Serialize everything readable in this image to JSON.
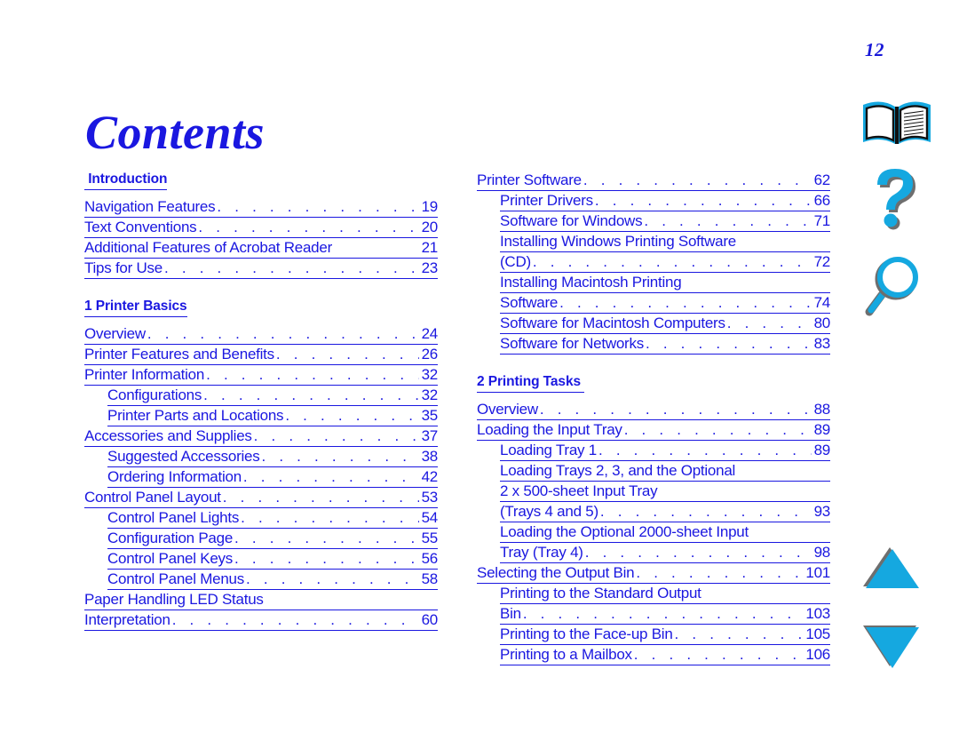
{
  "page": {
    "number": "12",
    "title": "Contents",
    "colors": {
      "link_blue": "#1a17e0",
      "icon_cyan": "#15a8e0",
      "icon_shadow": "#6e6e6e",
      "background": "#ffffff"
    }
  },
  "columns": [
    {
      "name": "left",
      "sections": [
        {
          "heading": " Introduction",
          "spaced_above": false,
          "entries": [
            {
              "level": 1,
              "lines": [
                "Navigation Features"
              ],
              "page": "19"
            },
            {
              "level": 1,
              "lines": [
                "Text Conventions"
              ],
              "page": "20"
            },
            {
              "level": 1,
              "lines": [
                "Additional Features of Acrobat Reader"
              ],
              "page": "21",
              "no_leader": true
            },
            {
              "level": 1,
              "lines": [
                "Tips for Use"
              ],
              "page": "23"
            }
          ]
        },
        {
          "heading": "1 Printer Basics",
          "spaced_above": true,
          "entries": [
            {
              "level": 1,
              "lines": [
                "Overview"
              ],
              "page": "24"
            },
            {
              "level": 1,
              "lines": [
                "Printer Features and Benefits"
              ],
              "page": "26"
            },
            {
              "level": 1,
              "lines": [
                "Printer Information"
              ],
              "page": "32"
            },
            {
              "level": 2,
              "lines": [
                "Configurations"
              ],
              "page": "32"
            },
            {
              "level": 2,
              "lines": [
                "Printer Parts and Locations"
              ],
              "page": "35"
            },
            {
              "level": 1,
              "lines": [
                "Accessories and Supplies"
              ],
              "page": "37"
            },
            {
              "level": 2,
              "lines": [
                "Suggested Accessories"
              ],
              "page": "38"
            },
            {
              "level": 2,
              "lines": [
                "Ordering Information"
              ],
              "page": "42"
            },
            {
              "level": 1,
              "lines": [
                "Control Panel Layout"
              ],
              "page": "53"
            },
            {
              "level": 2,
              "lines": [
                "Control Panel Lights"
              ],
              "page": "54"
            },
            {
              "level": 2,
              "lines": [
                "Configuration Page"
              ],
              "page": "55"
            },
            {
              "level": 2,
              "lines": [
                "Control Panel Keys"
              ],
              "page": "56"
            },
            {
              "level": 2,
              "lines": [
                "Control Panel Menus"
              ],
              "page": "58"
            },
            {
              "level": 1,
              "lines": [
                "Paper Handling LED Status ",
                "Interpretation"
              ],
              "page": "60"
            }
          ]
        }
      ]
    },
    {
      "name": "right",
      "sections": [
        {
          "heading": "",
          "spaced_above": false,
          "entries": [
            {
              "level": 1,
              "lines": [
                "Printer Software"
              ],
              "page": "62"
            },
            {
              "level": 2,
              "lines": [
                "Printer Drivers"
              ],
              "page": "66"
            },
            {
              "level": 2,
              "lines": [
                "Software for Windows"
              ],
              "page": "71"
            },
            {
              "level": 2,
              "lines": [
                "Installing Windows Printing Software ",
                "(CD)"
              ],
              "page": "72"
            },
            {
              "level": 2,
              "lines": [
                "Installing Macintosh Printing ",
                "Software"
              ],
              "page": "74"
            },
            {
              "level": 2,
              "lines": [
                "Software for Macintosh Computers"
              ],
              "page": "80"
            },
            {
              "level": 2,
              "lines": [
                "Software for Networks"
              ],
              "page": "83"
            }
          ]
        },
        {
          "heading": "2 Printing Tasks ",
          "spaced_above": true,
          "entries": [
            {
              "level": 1,
              "lines": [
                "Overview"
              ],
              "page": "88"
            },
            {
              "level": 1,
              "lines": [
                "Loading the Input Tray"
              ],
              "page": "89"
            },
            {
              "level": 2,
              "lines": [
                "Loading Tray 1"
              ],
              "page": "89"
            },
            {
              "level": 2,
              "lines": [
                "Loading Trays 2, 3, and the Optional ",
                "2 x 500-sheet Input Tray ",
                "(Trays 4 and 5)"
              ],
              "page": "93"
            },
            {
              "level": 2,
              "lines": [
                "Loading the Optional 2000-sheet Input ",
                "Tray (Tray 4)"
              ],
              "page": "98"
            },
            {
              "level": 1,
              "lines": [
                "Selecting the Output Bin"
              ],
              "page": "101"
            },
            {
              "level": 2,
              "lines": [
                "Printing to the Standard Output ",
                "Bin"
              ],
              "page": "103"
            },
            {
              "level": 2,
              "lines": [
                "Printing to the Face-up Bin"
              ],
              "page": "105"
            },
            {
              "level": 2,
              "lines": [
                "Printing to a Mailbox"
              ],
              "page": "106"
            }
          ]
        }
      ]
    }
  ],
  "icons": [
    {
      "name": "open-book-icon",
      "label": "Table of Contents"
    },
    {
      "name": "question-mark-icon",
      "label": "Help"
    },
    {
      "name": "magnifier-icon",
      "label": "Search"
    },
    {
      "name": "arrow-up-icon",
      "label": "Previous Page"
    },
    {
      "name": "arrow-down-icon",
      "label": "Next Page"
    }
  ]
}
